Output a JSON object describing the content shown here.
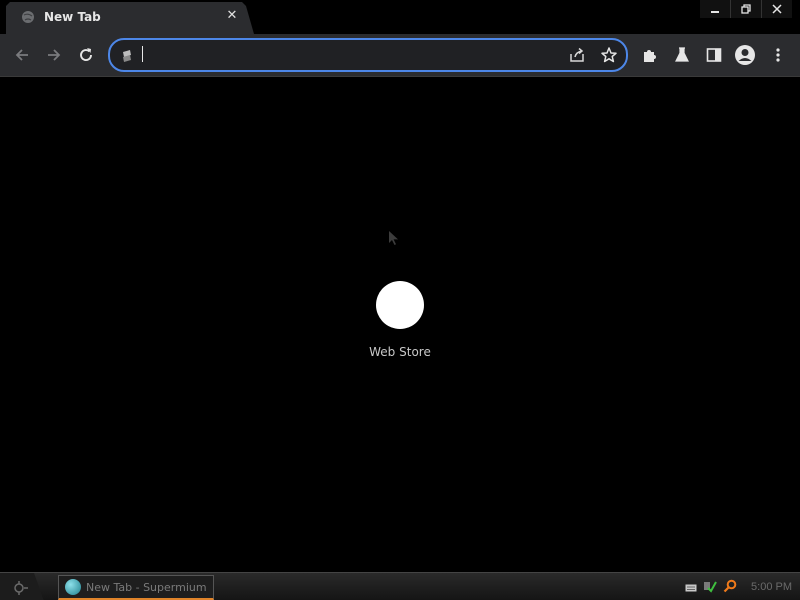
{
  "tabs": [
    {
      "title": "New Tab",
      "favicon": "globe-icon",
      "close_icon": "close-icon"
    }
  ],
  "window_controls": {
    "minimize": "minimize-icon",
    "restore": "restore-icon",
    "close": "close-icon"
  },
  "toolbar": {
    "back_icon": "arrow-left-icon",
    "forward_icon": "arrow-right-icon",
    "reload_icon": "reload-icon",
    "extensions_icon": "puzzle-icon",
    "labs_icon": "flask-icon",
    "side_panel_icon": "side-panel-icon",
    "profile_icon": "avatar-icon",
    "menu_icon": "more-vertical-icon"
  },
  "omnibox": {
    "value": "",
    "placeholder": "",
    "site_icon": "search-engine-icon",
    "share_icon": "share-icon",
    "bookmark_icon": "star-icon"
  },
  "shortcuts": [
    {
      "label": "Web Store"
    }
  ],
  "taskbar": {
    "task_item_label": "New Tab - Supermium",
    "clock": "5:00 PM",
    "tray_icons": [
      "keyboard-icon",
      "network-icon",
      "search-icon"
    ]
  },
  "colors": {
    "accent": "#4d87e8",
    "toolbar": "#2b2c2f",
    "background": "#000000",
    "taskbar_highlight": "#e0842a"
  }
}
